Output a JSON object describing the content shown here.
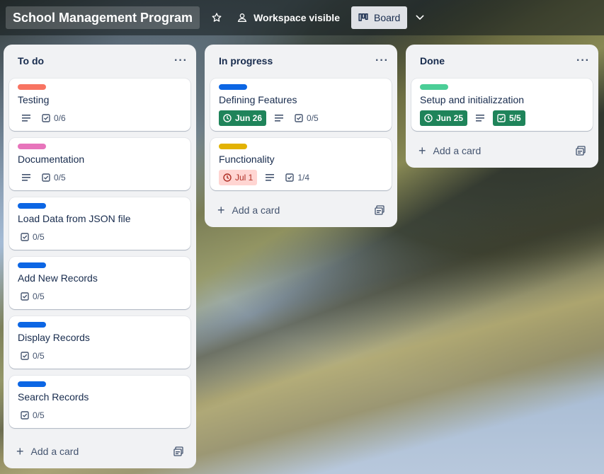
{
  "header": {
    "board_title": "School Management Program",
    "visibility_label": "Workspace visible",
    "view_label": "Board"
  },
  "colors": {
    "red": "#f87462",
    "pink": "#e774bb",
    "blue": "#0c66e4",
    "yellow": "#e2b203",
    "green": "#4bce97",
    "done_green": "#1f845a",
    "overdue_bg": "#ffd5d2"
  },
  "lists": [
    {
      "title": "To do",
      "add_card_label": "Add a card",
      "cards": [
        {
          "label_color": "red",
          "title": "Testing",
          "has_description": true,
          "checklist": "0/6"
        },
        {
          "label_color": "pink",
          "title": "Documentation",
          "has_description": true,
          "checklist": "0/5"
        },
        {
          "label_color": "blue",
          "title": "Load Data from JSON file",
          "has_description": false,
          "checklist": "0/5"
        },
        {
          "label_color": "blue",
          "title": "Add New Records",
          "has_description": false,
          "checklist": "0/5"
        },
        {
          "label_color": "blue",
          "title": "Display Records",
          "has_description": false,
          "checklist": "0/5"
        },
        {
          "label_color": "blue",
          "title": "Search Records",
          "has_description": false,
          "checklist": "0/5"
        }
      ]
    },
    {
      "title": "In progress",
      "add_card_label": "Add a card",
      "cards": [
        {
          "label_color": "blue",
          "title": "Defining Features",
          "due": "Jun 26",
          "due_status": "complete",
          "has_description": true,
          "checklist": "0/5"
        },
        {
          "label_color": "yellow",
          "title": "Functionality",
          "due": "Jul 1",
          "due_status": "overdue",
          "has_description": true,
          "checklist": "1/4"
        }
      ]
    },
    {
      "title": "Done",
      "add_card_label": "Add a card",
      "cards": [
        {
          "label_color": "green",
          "title": "Setup and initializzation",
          "due": "Jun 25",
          "due_status": "complete",
          "has_description": true,
          "checklist": "5/5",
          "checklist_complete": true
        }
      ]
    }
  ]
}
